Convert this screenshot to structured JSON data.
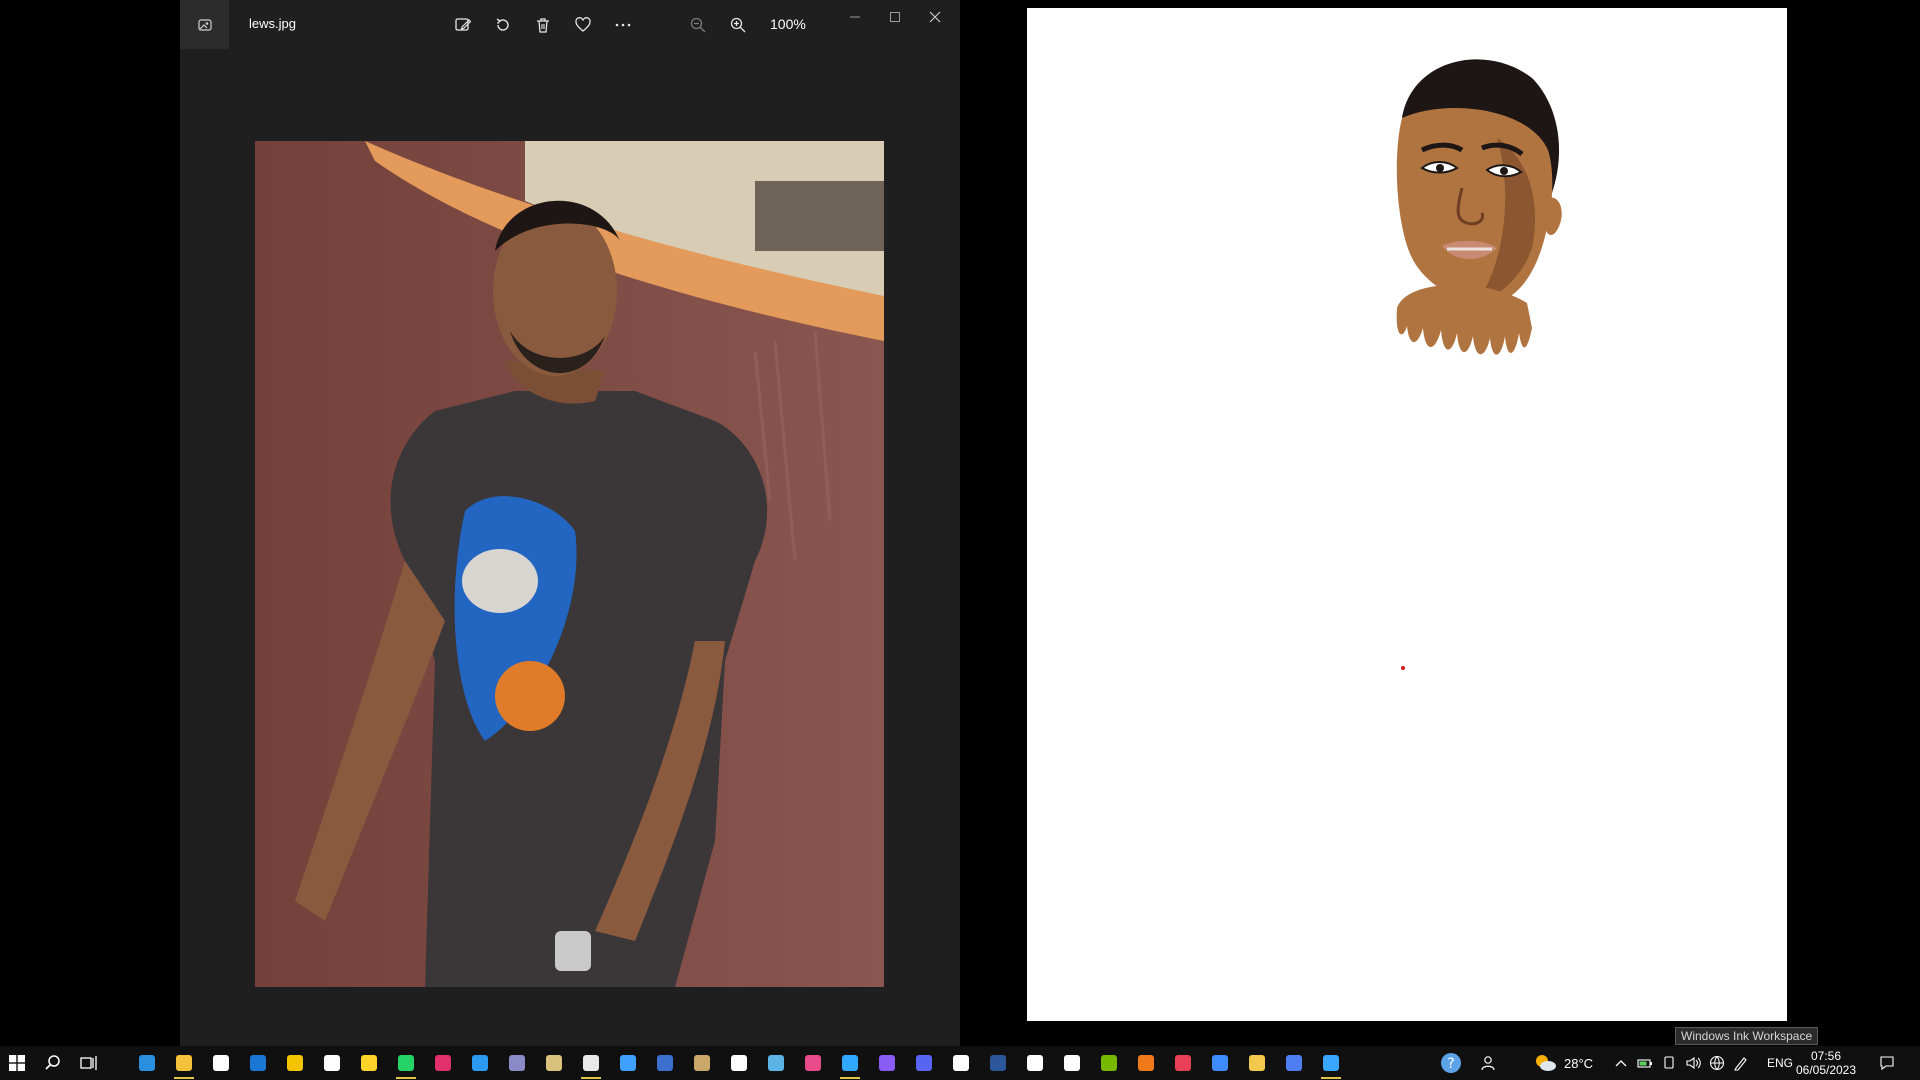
{
  "viewer": {
    "file_name": "lews.jpg",
    "zoom": "100%",
    "toolbar": [
      "edit-image-icon",
      "rotate-icon",
      "delete-icon",
      "favorite-icon",
      "more-icon",
      "zoom-out-icon",
      "zoom-in-icon"
    ]
  },
  "tooltip": {
    "text": "Windows Ink Workspace"
  },
  "taskbar": {
    "apps": [
      {
        "name": "edge",
        "color": "#2b8fe0",
        "active": false
      },
      {
        "name": "file-explorer",
        "color": "#f2c23a",
        "active": true
      },
      {
        "name": "store",
        "color": "#ffffff",
        "active": false
      },
      {
        "name": "mail",
        "color": "#1a78d4",
        "active": false
      },
      {
        "name": "app-yellow",
        "color": "#f5c400",
        "active": false
      },
      {
        "name": "tiktok",
        "color": "#ffffff",
        "active": false
      },
      {
        "name": "app-yellow-2",
        "color": "#ffd42a",
        "active": false
      },
      {
        "name": "whatsapp",
        "color": "#25d366",
        "active": true
      },
      {
        "name": "instagram",
        "color": "#e1306c",
        "active": false
      },
      {
        "name": "vscode",
        "color": "#2b9af3",
        "active": false
      },
      {
        "name": "app-gray",
        "color": "#8a8ac7",
        "active": false
      },
      {
        "name": "app-tools",
        "color": "#d9c27c",
        "active": false
      },
      {
        "name": "chrome",
        "color": "#e8e8e8",
        "active": true
      },
      {
        "name": "app-blue-circle",
        "color": "#3fa0ff",
        "active": false
      },
      {
        "name": "app-blue-square",
        "color": "#3c6fcf",
        "active": false
      },
      {
        "name": "app-image",
        "color": "#c9a86a",
        "active": false
      },
      {
        "name": "app-b",
        "color": "#ffffff",
        "active": false
      },
      {
        "name": "app-globe",
        "color": "#5bb4e5",
        "active": false
      },
      {
        "name": "app-pink",
        "color": "#e84a8a",
        "active": false
      },
      {
        "name": "photoshop",
        "color": "#31a8ff",
        "active": true
      },
      {
        "name": "app-purple",
        "color": "#8a5cf6",
        "active": false
      },
      {
        "name": "discord",
        "color": "#5865f2",
        "active": false
      },
      {
        "name": "app-s",
        "color": "#ffffff",
        "active": false
      },
      {
        "name": "word",
        "color": "#2b579a",
        "active": false
      },
      {
        "name": "app-x",
        "color": "#ffffff",
        "active": false
      },
      {
        "name": "app-arrow",
        "color": "#ffffff",
        "active": false
      },
      {
        "name": "nvidia",
        "color": "#76b900",
        "active": false
      },
      {
        "name": "app-orange",
        "color": "#f07a1a",
        "active": false
      },
      {
        "name": "app-drop",
        "color": "#e94057",
        "active": false
      },
      {
        "name": "app-blue-minus",
        "color": "#3d8bff",
        "active": false
      },
      {
        "name": "app-gem",
        "color": "#f2c94c",
        "active": false
      },
      {
        "name": "app-swirl",
        "color": "#4f7df2",
        "active": false
      },
      {
        "name": "app-window",
        "color": "#39a6ff",
        "active": true
      }
    ],
    "tray": {
      "temperature": "28°C",
      "language": "ENG",
      "time": "07:56",
      "date": "06/05/2023"
    }
  }
}
